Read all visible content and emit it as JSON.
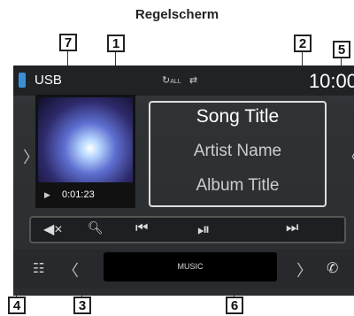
{
  "heading": "Regelscherm",
  "callouts": {
    "c1": "1",
    "c2": "2",
    "c3": "3",
    "c4": "4",
    "c5": "5",
    "c6": "6",
    "c7": "7"
  },
  "topbar": {
    "source": "USB",
    "time": "10:00",
    "repeat_icon": "repeat-all-icon",
    "shuffle_icon": "shuffle-icon",
    "repeat_text": "ALL"
  },
  "artwork": {
    "elapsed": "0:01:23"
  },
  "track": {
    "song": "Song Title",
    "artist": "Artist Name",
    "album": "Album Title"
  },
  "controls": [
    "mute-icon",
    "search-icon",
    "previous-icon",
    "play-pause-icon",
    "next-icon"
  ],
  "bottombar": {
    "source_label": "MUSIC"
  }
}
